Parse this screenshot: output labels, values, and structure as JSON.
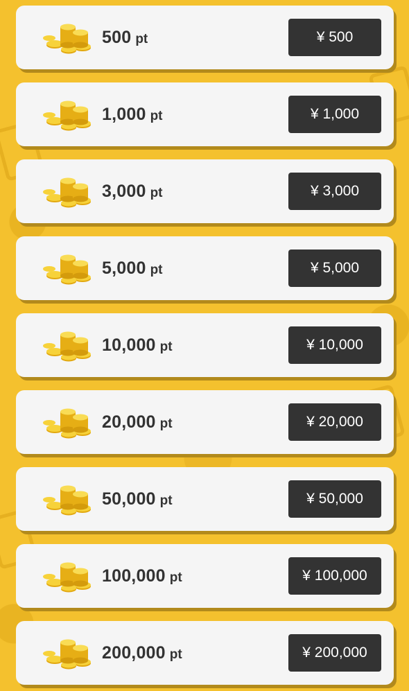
{
  "unit": "pt",
  "currency_symbol": "¥",
  "items": [
    {
      "points": "500",
      "price": "¥ 500"
    },
    {
      "points": "1,000",
      "price": "¥ 1,000"
    },
    {
      "points": "3,000",
      "price": "¥ 3,000"
    },
    {
      "points": "5,000",
      "price": "¥ 5,000"
    },
    {
      "points": "10,000",
      "price": "¥ 10,000"
    },
    {
      "points": "20,000",
      "price": "¥ 20,000"
    },
    {
      "points": "50,000",
      "price": "¥ 50,000"
    },
    {
      "points": "100,000",
      "price": "¥ 100,000"
    },
    {
      "points": "200,000",
      "price": "¥ 200,000"
    }
  ],
  "colors": {
    "background": "#f4c12e",
    "card": "#f5f5f5",
    "button": "#333333",
    "button_text": "#ffffff",
    "coin": "#f2c21b"
  },
  "icons": {
    "coin_stack": "coin-stack-icon"
  }
}
